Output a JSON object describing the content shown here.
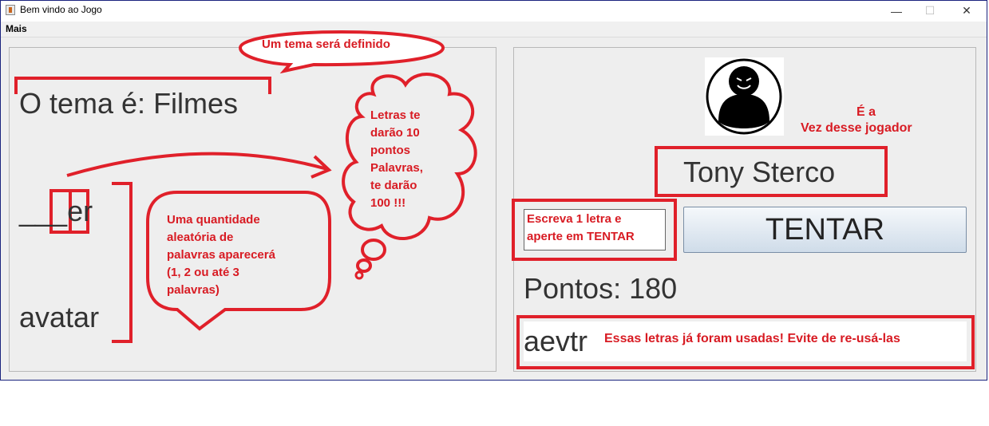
{
  "window": {
    "title": "Bem vindo ao Jogo",
    "minimize": "—",
    "maximize": "☐",
    "close": "✕"
  },
  "menu": {
    "items": [
      "Mais"
    ]
  },
  "left_panel": {
    "theme_text": "O tema é: Filmes",
    "words": [
      "___er",
      "avatar"
    ],
    "annotations": {
      "theme_bubble": "Um tema será definido",
      "cloud_lines": [
        "Letras te",
        "darão 10",
        "pontos",
        "Palavras,",
        "te darão",
        "100 !!!"
      ],
      "words_bubble_lines": [
        "Uma quantidade",
        "aleatória de",
        "palavras aparecerá",
        "(1, 2 ou até 3",
        "palavras)"
      ]
    }
  },
  "right_panel": {
    "avatar_icon": "player-avatar-icon",
    "turn_note_lines": [
      "É a",
      "Vez desse jogador"
    ],
    "player_name": "Tony Sterco",
    "input_hint_lines": [
      "Escreva 1 letra e",
      "aperte em TENTAR"
    ],
    "try_button": "TENTAR",
    "points_text": "Pontos: 180",
    "used_letters": "aevtr",
    "used_note": "Essas letras já foram usadas! Evite de re-usá-las"
  },
  "colors": {
    "annotation_red": "#e0202a",
    "title_bar_border": "#1a237e",
    "button_gradient_bottom": "#cfdce9"
  }
}
